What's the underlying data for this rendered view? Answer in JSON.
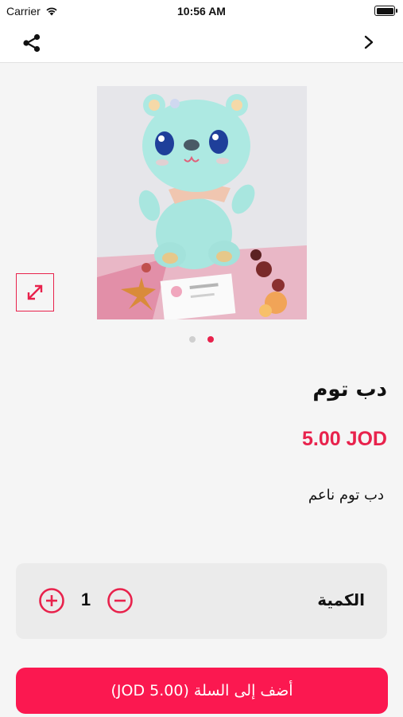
{
  "status_bar": {
    "carrier": "Carrier",
    "time": "10:56 AM"
  },
  "nav": {
    "share_icon": "share-icon",
    "back_icon": "chevron-right-icon"
  },
  "gallery": {
    "slide_count": 2,
    "active_slide": 2,
    "expand_icon": "expand-icon"
  },
  "product": {
    "title": "دب توم",
    "price": "5.00 JOD",
    "description": "دب توم ناعم"
  },
  "quantity": {
    "label": "الكمية",
    "value": "1",
    "plus_icon": "plus-circle-icon",
    "minus_icon": "minus-circle-icon"
  },
  "cart": {
    "button_label": "أضف إلى السلة (5.00 JOD)"
  },
  "colors": {
    "accent": "#e8224c",
    "button": "#fb1850"
  }
}
